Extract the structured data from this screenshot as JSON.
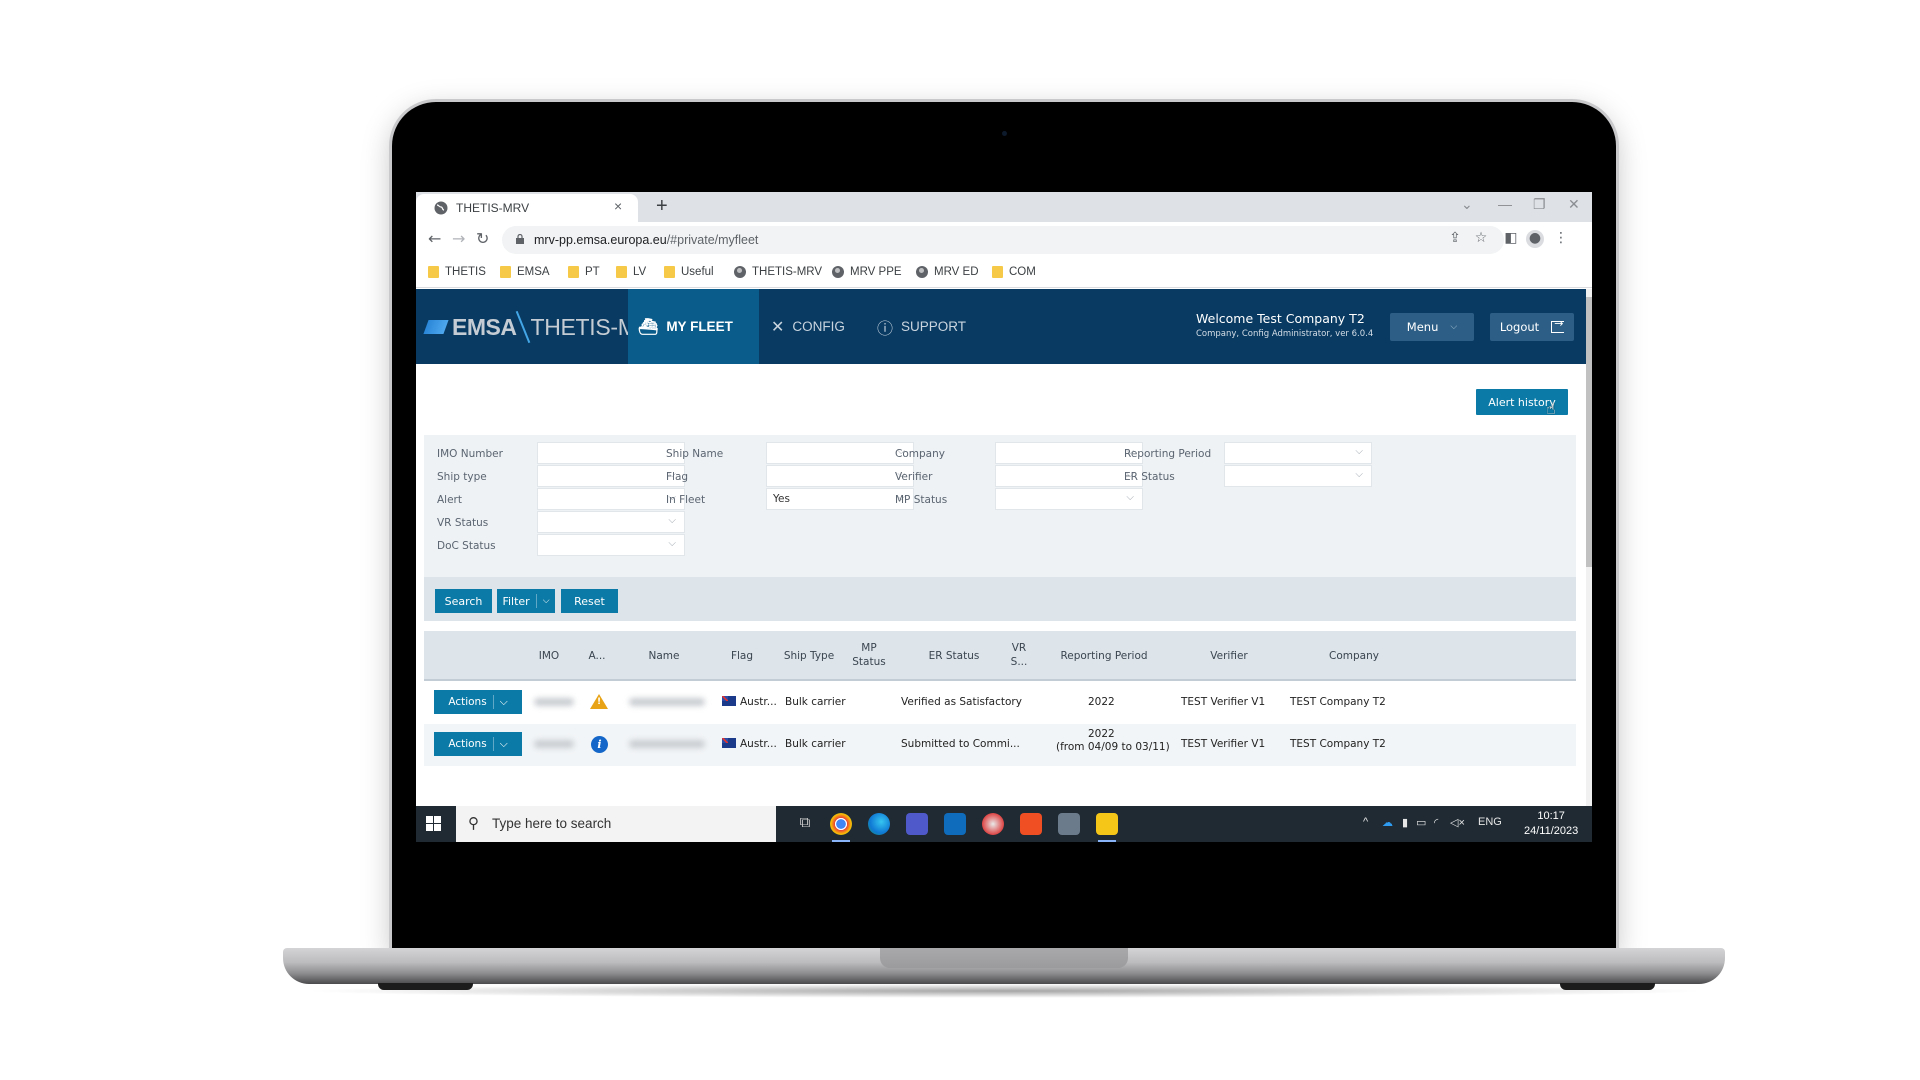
{
  "browser": {
    "tab_title": "THETIS-MRV",
    "new_tab_symbol": "+",
    "close_symbol": "×",
    "url_host": "mrv-pp.emsa.europa.eu",
    "url_path": "/#private/myfleet",
    "bookmarks": [
      {
        "label": "THETIS",
        "icon": "folder-icon"
      },
      {
        "label": "EMSA",
        "icon": "folder-icon"
      },
      {
        "label": "PT",
        "icon": "folder-icon"
      },
      {
        "label": "LV",
        "icon": "folder-icon"
      },
      {
        "label": "Useful",
        "icon": "folder-icon"
      },
      {
        "label": "THETIS-MRV",
        "icon": "globe-icon"
      },
      {
        "label": "MRV PPE",
        "icon": "globe-icon"
      },
      {
        "label": "MRV ED",
        "icon": "globe-icon"
      },
      {
        "label": "COM",
        "icon": "folder-icon"
      }
    ]
  },
  "app": {
    "logo_emsa": "EMSA",
    "logo_product": "THETIS-MRV",
    "nav": [
      {
        "label": "MY FLEET",
        "icon": "ship-icon",
        "active": true
      },
      {
        "label": "CONFIG",
        "icon": "tools-icon",
        "active": false
      },
      {
        "label": "SUPPORT",
        "icon": "info-circle-icon",
        "active": false
      }
    ],
    "welcome_title": "Welcome Test Company T2",
    "welcome_subtitle": "Company, Config Administrator, ver 6.0.4",
    "menu_label": "Menu",
    "logout_label": "Logout",
    "alert_history_label": "Alert history",
    "colors": {
      "header": "#083a62",
      "active_nav": "#0a5c8a",
      "primary_button": "#0b7aa6"
    }
  },
  "filters": {
    "imo_number": {
      "label": "IMO Number",
      "value": ""
    },
    "ship_name": {
      "label": "Ship Name",
      "value": ""
    },
    "company": {
      "label": "Company",
      "value": ""
    },
    "reporting_period": {
      "label": "Reporting Period",
      "value": ""
    },
    "ship_type": {
      "label": "Ship type",
      "value": ""
    },
    "flag": {
      "label": "Flag",
      "value": ""
    },
    "verifier": {
      "label": "Verifier",
      "value": ""
    },
    "er_status": {
      "label": "ER Status",
      "value": ""
    },
    "alert": {
      "label": "Alert",
      "value": ""
    },
    "in_fleet": {
      "label": "In Fleet",
      "value": "Yes"
    },
    "mp_status": {
      "label": "MP Status",
      "value": ""
    },
    "vr_status": {
      "label": "VR Status",
      "value": ""
    },
    "doc_status": {
      "label": "DoC Status",
      "value": ""
    }
  },
  "buttons": {
    "search": "Search",
    "filter": "Filter",
    "reset": "Reset"
  },
  "table": {
    "columns": {
      "imo": "IMO",
      "alert": "A...",
      "name": "Name",
      "flag": "Flag",
      "ship_type": "Ship Type",
      "mp_status_1": "MP",
      "mp_status_2": "Status",
      "er_status": "ER Status",
      "vr_status_1": "VR",
      "vr_status_2": "S...",
      "reporting_period": "Reporting Period",
      "verifier": "Verifier",
      "company": "Company"
    },
    "rows": [
      {
        "actions_label": "Actions",
        "alert_icon": "warning-icon",
        "flag": "Austr...",
        "ship_type": "Bulk carrier",
        "mp_status": "",
        "er_status": "Verified as Satisfactory",
        "vr_status": "",
        "reporting_period": "2022",
        "reporting_period_sub": "",
        "verifier": "TEST Verifier V1",
        "company": "TEST Company T2"
      },
      {
        "actions_label": "Actions",
        "alert_icon": "info-icon",
        "flag": "Austr...",
        "ship_type": "Bulk carrier",
        "mp_status": "",
        "er_status": "Submitted to Commi...",
        "vr_status": "",
        "reporting_period": "2022",
        "reporting_period_sub": "(from 04/09 to 03/11)",
        "verifier": "TEST Verifier V1",
        "company": "TEST Company T2"
      }
    ]
  },
  "taskbar": {
    "search_placeholder": "Type here to search",
    "language": "ENG",
    "time": "10:17",
    "date": "24/11/2023",
    "apps": [
      "task-view",
      "chrome",
      "edge",
      "teams",
      "outlook",
      "snipping-tool",
      "sublime",
      "calculator",
      "sticky-notes"
    ]
  }
}
